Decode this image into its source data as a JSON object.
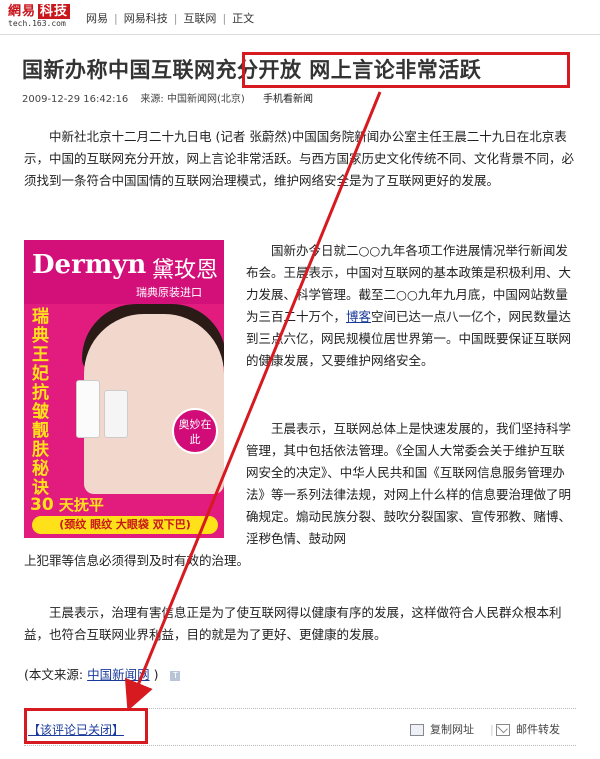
{
  "logo": {
    "brand": "網易",
    "brand_badge": "科技",
    "url": "tech.163.com"
  },
  "breadcrumb": [
    "网易",
    "网易科技",
    "互联网",
    "正文"
  ],
  "breadcrumb_sep": "|",
  "article": {
    "title": "国新办称中国互联网充分开放  网上言论非常活跃",
    "date": "2009-12-29 16:42:16",
    "source_label": "来源: 中国新闻网(北京)",
    "mobile_link": "手机看新闻",
    "p1": "中新社北京十二月二十九日电 (记者 张蔚然)中国国务院新闻办公室主任王晨二十九日在北京表示，中国的互联网充分开放，网上言论非常活跃。与西方国家历史文化传统不同、文化背景不同，必须找到一条符合中国国情的互联网治理模式，维护网络安全是为了互联网更好的发展。",
    "p2_before": "国新办今日就二○○九年各项工作进展情况举行新闻发布会。王晨表示，中国对互联网的基本政策是积极利用、大力发展、科学管理。截至二○○九年九月底，中国网站数量为三百二十万个，",
    "p2_link": "博客",
    "p2_after": "空间已达一点八一亿个，网民数量达到三点六亿，网民规模位居世界第一。中国既要保证互联网的健康发展，又要维护网络安全。",
    "p3": "王晨表示，互联网总体上是快速发展的，我们坚持科学管理，其中包括依法管理。《全国人大常委会关于维护互联网安全的决定》、中华人民共和国《互联网信息服务管理办法》等一系列法律法规，对网上什么样的信息要治理做了明确规定。煽动民族分裂、鼓吹分裂国家、宣传邪教、赌博、淫秽色情、鼓动网",
    "p3b": "上犯罪等信息必须得到及时有效的治理。",
    "p4": "王晨表示，治理有害信息正是为了使互联网得以健康有序的发展，这样做符合人民群众根本利益，也符合互联网业界利益，目的就是为了更好、更健康的发展。",
    "source_prefix": "(本文来源:",
    "source_name": "中国新闻网",
    "source_suffix": ")",
    "source_icon": "T"
  },
  "ad": {
    "brand_en": "Dermyn",
    "brand_cn": "黛玫恩",
    "origin": "瑞典原装进口",
    "vertical_text": "瑞典王妃抗皱靓肤秘诀",
    "badge": "奥妙在此",
    "days_num": "30",
    "days_text": "天抚平",
    "pill": "(颈纹 眼纹 大眼袋 双下巴)"
  },
  "footer": {
    "comment_closed": "【该评论已关闭】",
    "copy_url": "复制网址",
    "mail_forward": "邮件转发"
  },
  "colors": {
    "highlight": "#d71920",
    "link": "#1a3a9a",
    "logo_red": "#c8161d"
  }
}
